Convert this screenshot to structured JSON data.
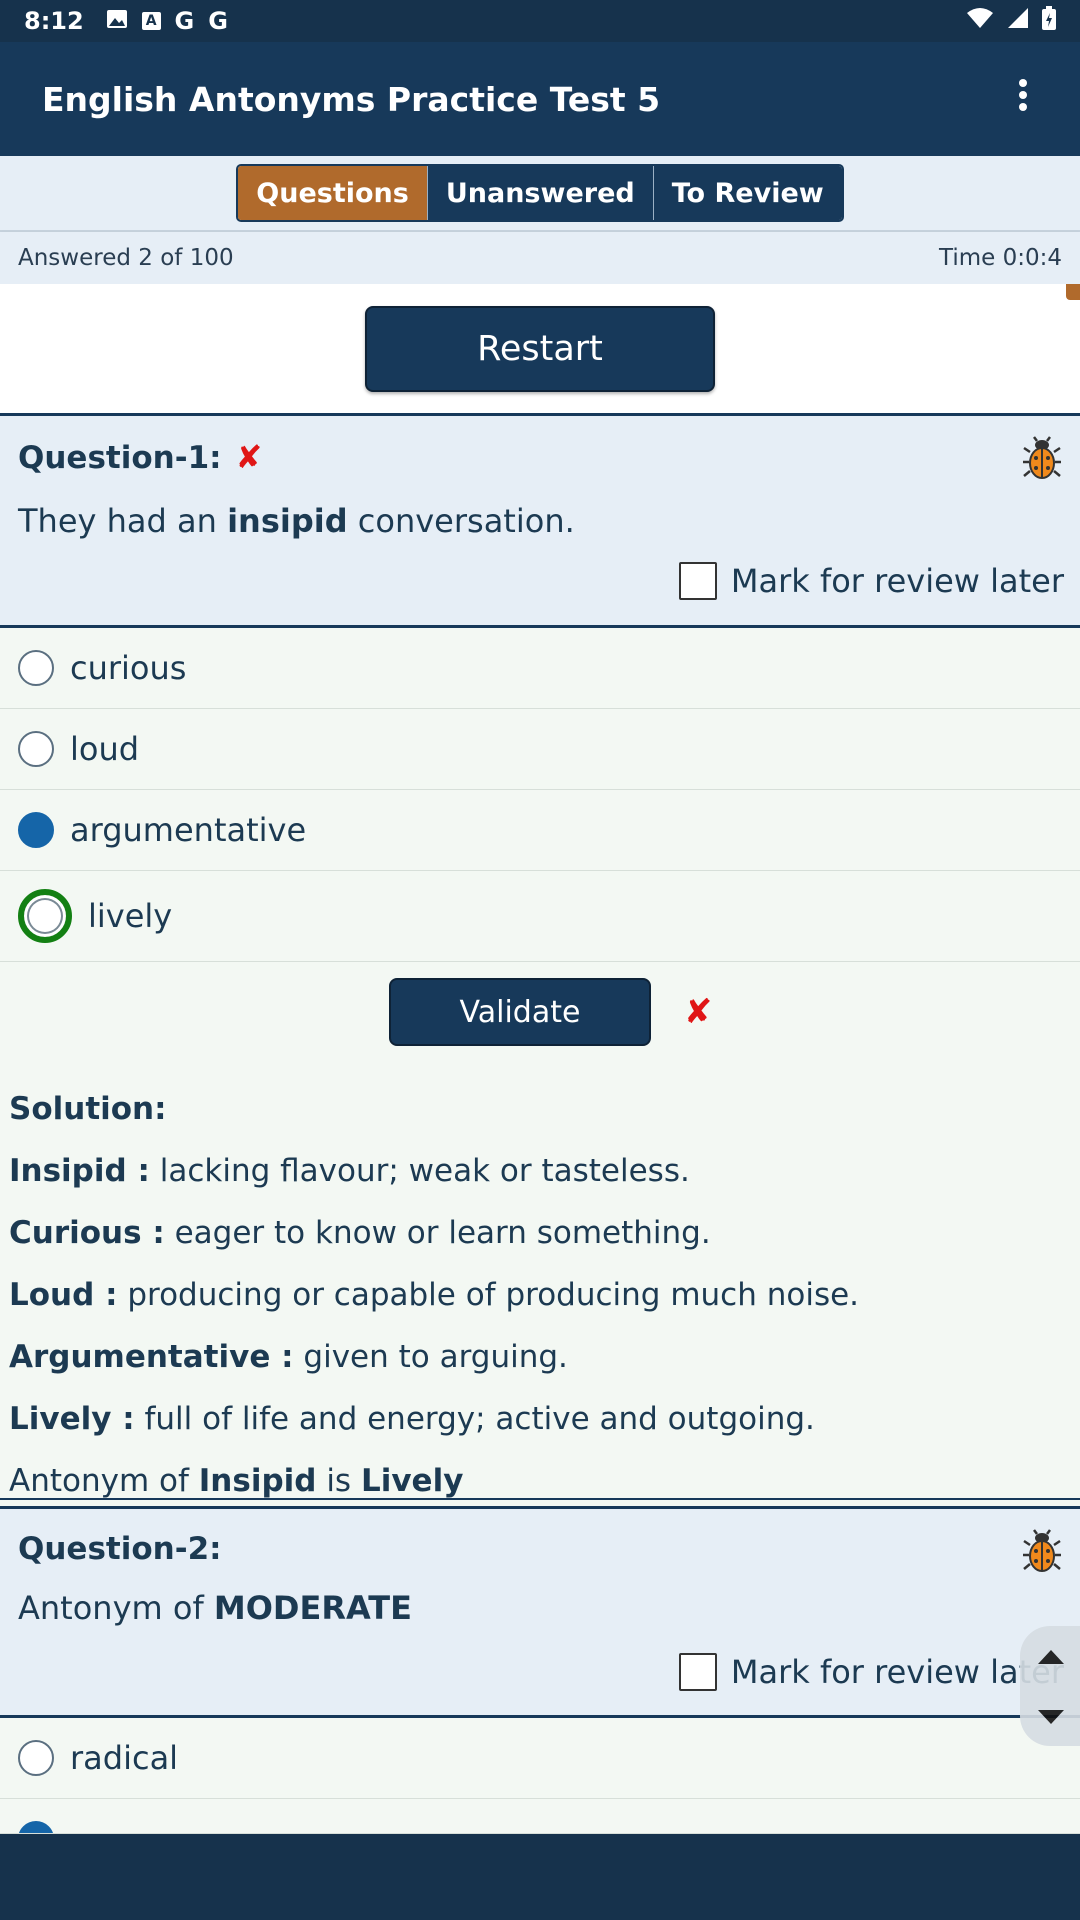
{
  "status_bar": {
    "time": "8:12",
    "icons": [
      "image-icon",
      "a-icon",
      "g-icon",
      "g-icon",
      "wifi-icon",
      "signal-icon",
      "battery-icon"
    ],
    "g1": "G",
    "g2": "G",
    "a": "A"
  },
  "app_bar": {
    "title": "English Antonyms Practice Test 5"
  },
  "tabs": [
    {
      "label": "Questions",
      "active": true
    },
    {
      "label": "Unanswered",
      "active": false
    },
    {
      "label": "To Review",
      "active": false
    }
  ],
  "progress": {
    "answered": "Answered 2 of 100",
    "time": "Time 0:0:4"
  },
  "restart_label": "Restart",
  "question1": {
    "label": "Question-1:",
    "wrong_mark": "✘",
    "text_pre": "They had an ",
    "text_bold": "insipid",
    "text_post": " conversation.",
    "review_label": "Mark for review later",
    "options": [
      "curious",
      "loud",
      "argumentative",
      "lively"
    ],
    "selected": "argumentative",
    "correct": "lively",
    "validate_label": "Validate",
    "validate_mark": "✘",
    "solution": {
      "heading": "Solution:",
      "lines": [
        {
          "term": "Insipid :",
          "def": " lacking flavour; weak or tasteless."
        },
        {
          "term": "Curious :",
          "def": " eager to know or learn something."
        },
        {
          "term": "Loud :",
          "def": " producing or capable of producing much noise."
        },
        {
          "term": "Argumentative :",
          "def": " given to arguing."
        },
        {
          "term": "Lively :",
          "def": " full of life and energy; active and outgoing."
        }
      ],
      "summary_pre": "Antonym of ",
      "summary_word": "Insipid",
      "summary_mid": " is ",
      "summary_answer": "Lively"
    }
  },
  "question2": {
    "label": "Question-2:",
    "text_pre": "Antonym of ",
    "text_bold": "MODERATE",
    "review_label": "Mark for review later",
    "options": [
      "radical"
    ]
  },
  "colors": {
    "primary": "#17395a",
    "accent": "#b06a2c",
    "wrong": "#e01616",
    "correct": "#138013",
    "selected": "#1565a8"
  }
}
